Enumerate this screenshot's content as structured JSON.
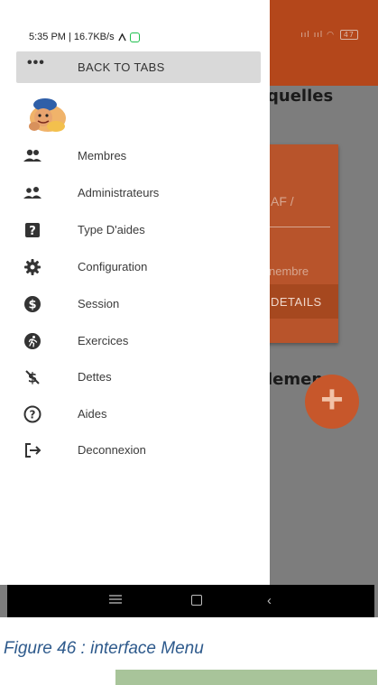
{
  "status_bar": {
    "text": "5:35 PM | 16.7KB/s",
    "signal": "ııl ııl",
    "battery": "47"
  },
  "drawer": {
    "back_label": "BACK TO TABS",
    "items": [
      {
        "label": "Membres",
        "icon": "group-icon"
      },
      {
        "label": "Administrateurs",
        "icon": "supervisor-icon"
      },
      {
        "label": "Type D'aides",
        "icon": "help-box-icon"
      },
      {
        "label": "Configuration",
        "icon": "gear-icon"
      },
      {
        "label": "Session",
        "icon": "dollar-circle-icon"
      },
      {
        "label": "Exercices",
        "icon": "running-icon"
      },
      {
        "label": "Dettes",
        "icon": "money-off-icon"
      },
      {
        "label": "Aides",
        "icon": "help-circle-icon"
      },
      {
        "label": "Deconnexion",
        "icon": "logout-icon"
      }
    ]
  },
  "background": {
    "heading": "quelles",
    "card_text": "AF /",
    "card_membre": "nembre",
    "card_details": "DETAILS",
    "heading2": "lemen",
    "fab": "+"
  },
  "caption": "Figure 46 : interface Menu",
  "colors": {
    "app_bar": "#b4471b",
    "card": "#b8542b",
    "fab": "#c7572b",
    "caption": "#2e5a8c",
    "whatsapp": "#1fbf4e"
  }
}
